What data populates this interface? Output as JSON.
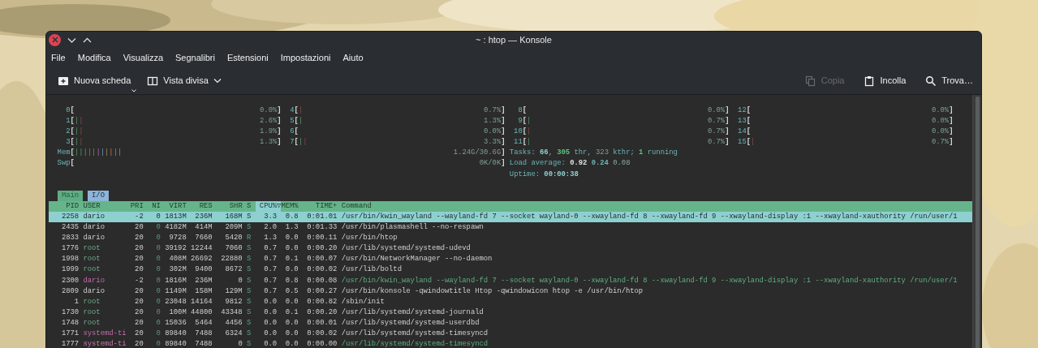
{
  "window": {
    "title": "~ : htop — Konsole"
  },
  "menu": [
    "File",
    "Modifica",
    "Visualizza",
    "Segnalibri",
    "Estensioni",
    "Impostazioni",
    "Aiuto"
  ],
  "toolbar": {
    "left": [
      {
        "label": "Nuova scheda",
        "kind": "new-tab"
      },
      {
        "label": "Vista divisa",
        "kind": "split"
      }
    ],
    "right": [
      {
        "label": "Copia",
        "kind": "copy",
        "disabled": true
      },
      {
        "label": "Incolla",
        "kind": "paste",
        "disabled": false
      },
      {
        "label": "Trova…",
        "kind": "find",
        "disabled": false
      }
    ]
  },
  "htop": {
    "meter_brackets": [
      "[",
      "]"
    ],
    "cpu_meters": [
      {
        "label": "0",
        "value": "0.0%"
      },
      {
        "label": "4",
        "bars": [
          {
            "text": "|",
            "kind": "kernel"
          }
        ],
        "value": "0.7%"
      },
      {
        "label": "8",
        "value": "0.0%"
      },
      {
        "label": "12",
        "value": "0.0%"
      },
      {
        "label": "1",
        "bars": [
          {
            "text": "|",
            "kind": "user"
          },
          {
            "text": "|",
            "kind": "kernel"
          }
        ],
        "value": "2.6%"
      },
      {
        "label": "5",
        "bars": [
          {
            "text": "|",
            "kind": "user"
          }
        ],
        "value": "1.3%"
      },
      {
        "label": "9",
        "bars": [
          {
            "text": "|",
            "kind": "user"
          }
        ],
        "value": "0.7%"
      },
      {
        "label": "13",
        "value": "0.0%"
      },
      {
        "label": "2",
        "bars": [
          {
            "text": "|",
            "kind": "user"
          },
          {
            "text": "|",
            "kind": "kernel"
          }
        ],
        "value": "1.9%"
      },
      {
        "label": "6",
        "value": "0.0%"
      },
      {
        "label": "10",
        "bars": [
          {
            "text": "|",
            "kind": "kernel"
          }
        ],
        "value": "0.7%"
      },
      {
        "label": "14",
        "value": "0.0%"
      },
      {
        "label": "3",
        "bars": [
          {
            "text": "|",
            "kind": "user"
          },
          {
            "text": "|",
            "kind": "kernel"
          }
        ],
        "value": "1.3%"
      },
      {
        "label": "7",
        "bars": [
          {
            "text": "|",
            "kind": "user"
          },
          {
            "text": "|",
            "kind": "kernel"
          }
        ],
        "value": "3.3%"
      },
      {
        "label": "11",
        "bars": [
          {
            "text": "|",
            "kind": "user"
          }
        ],
        "value": "0.7%"
      },
      {
        "label": "15",
        "bars": [
          {
            "text": "|",
            "kind": "kernel"
          }
        ],
        "value": "0.7%"
      }
    ],
    "memory": {
      "label": "Mem",
      "bars": [
        {
          "text": "|||||",
          "kind": "user"
        },
        {
          "text": "|",
          "kind": "shared"
        },
        {
          "text": "|",
          "kind": "buffers"
        },
        {
          "text": "||||",
          "kind": "cache"
        }
      ],
      "value": "1.24G/30.6G"
    },
    "swap": {
      "label": "Swp",
      "value": "0K/0K"
    },
    "tasks": [
      {
        "text": "Tasks: ",
        "kind": "label"
      },
      {
        "text": "66",
        "kind": "count"
      },
      {
        "text": ", ",
        "kind": "label"
      },
      {
        "text": "305",
        "kind": "highlight"
      },
      {
        "text": " thr, ",
        "kind": "label"
      },
      {
        "text": "323",
        "kind": "dim"
      },
      {
        "text": " kthr; ",
        "kind": "label"
      },
      {
        "text": "1",
        "kind": "highlight"
      },
      {
        "text": " running",
        "kind": "label"
      }
    ],
    "load_average": [
      {
        "text": "Load average: ",
        "kind": "label"
      },
      {
        "text": "0.92 ",
        "kind": "load1"
      },
      {
        "text": "0.24 ",
        "kind": "load5"
      },
      {
        "text": "0.08",
        "kind": "load15"
      }
    ],
    "uptime": [
      {
        "text": "Uptime: ",
        "kind": "label"
      },
      {
        "text": "00:00:38",
        "kind": "count"
      }
    ],
    "tabs": [
      {
        "label": "Main",
        "selected": true
      },
      {
        "label": "I/O",
        "selected": false
      }
    ],
    "columns": [
      {
        "label": "PID",
        "sorted": false
      },
      {
        "label": "USER",
        "sorted": false
      },
      {
        "label": "PRI",
        "sorted": false
      },
      {
        "label": "NI",
        "sorted": false
      },
      {
        "label": "VIRT",
        "sorted": false
      },
      {
        "label": "RES",
        "sorted": false
      },
      {
        "label": "SHR",
        "sorted": false
      },
      {
        "label": "S",
        "sorted": false
      },
      {
        "label": "CPU%",
        "sorted": true,
        "sort_indicator": "▽"
      },
      {
        "label": "MEM%",
        "sorted": false
      },
      {
        "label": "TIME+",
        "sorted": false
      },
      {
        "label": "Command",
        "sorted": false
      }
    ],
    "rows": [
      {
        "cells": [
          "2258",
          "dario",
          "-2",
          "0",
          "1813M",
          "236M",
          "168M",
          "S",
          "3.3",
          "0.8",
          "0:01.01",
          "/usr/bin/kwin_wayland --wayland-fd 7 --socket wayland-0 --xwayland-fd 8 --xwayland-fd 9 --xwayland-display :1 --xwayland-xauthority /run/user/1"
        ],
        "selected": true,
        "thread": false,
        "kind": "self"
      },
      {
        "cells": [
          "2435",
          "dario",
          "20",
          "0",
          "4182M",
          "414M",
          "209M",
          "S",
          "2.0",
          "1.3",
          "0:01.33",
          "/usr/bin/plasmashell --no-respawn"
        ],
        "selected": false,
        "thread": false,
        "kind": "self"
      },
      {
        "cells": [
          "2833",
          "dario",
          "20",
          "0",
          "9728",
          "7660",
          "5420",
          "R",
          "1.3",
          "0.0",
          "0:00.11",
          "/usr/bin/htop"
        ],
        "selected": false,
        "thread": false,
        "kind": "self"
      },
      {
        "cells": [
          "1776",
          "root",
          "20",
          "0",
          "39192",
          "12244",
          "7060",
          "S",
          "0.7",
          "0.0",
          "0:00.20",
          "/usr/lib/systemd/systemd-udevd"
        ],
        "selected": false,
        "thread": false,
        "kind": "root"
      },
      {
        "cells": [
          "1998",
          "root",
          "20",
          "0",
          "408M",
          "26692",
          "22880",
          "S",
          "0.7",
          "0.1",
          "0:00.07",
          "/usr/bin/NetworkManager --no-daemon"
        ],
        "selected": false,
        "thread": false,
        "kind": "root"
      },
      {
        "cells": [
          "1999",
          "root",
          "20",
          "0",
          "302M",
          "9400",
          "8672",
          "S",
          "0.7",
          "0.0",
          "0:00.02",
          "/usr/lib/boltd"
        ],
        "selected": false,
        "thread": false,
        "kind": "root"
      },
      {
        "cells": [
          "2300",
          "dario",
          "-2",
          "0",
          "1816M",
          "236M",
          "0",
          "S",
          "0.7",
          "0.8",
          "0:00.08",
          "/usr/bin/kwin_wayland --wayland-fd 7 --socket wayland-0 --xwayland-fd 8 --xwayland-fd 9 --xwayland-display :1 --xwayland-xauthority /run/user/1"
        ],
        "selected": false,
        "thread": true,
        "kind": "self"
      },
      {
        "cells": [
          "2809",
          "dario",
          "20",
          "0",
          "1149M",
          "158M",
          "129M",
          "S",
          "0.7",
          "0.5",
          "0:00.27",
          "/usr/bin/konsole -qwindowtitle Htop -qwindowicon htop -e /usr/bin/htop"
        ],
        "selected": false,
        "thread": false,
        "kind": "self"
      },
      {
        "cells": [
          "1",
          "root",
          "20",
          "0",
          "23048",
          "14164",
          "9812",
          "S",
          "0.0",
          "0.0",
          "0:00.82",
          "/sbin/init"
        ],
        "selected": false,
        "thread": false,
        "kind": "root"
      },
      {
        "cells": [
          "1730",
          "root",
          "20",
          "0",
          "100M",
          "44800",
          "43348",
          "S",
          "0.0",
          "0.1",
          "0:00.20",
          "/usr/lib/systemd/systemd-journald"
        ],
        "selected": false,
        "thread": false,
        "kind": "root"
      },
      {
        "cells": [
          "1748",
          "root",
          "20",
          "0",
          "15036",
          "5464",
          "4456",
          "S",
          "0.0",
          "0.0",
          "0:00.01",
          "/usr/lib/systemd/systemd-userdbd"
        ],
        "selected": false,
        "thread": false,
        "kind": "root"
      },
      {
        "cells": [
          "1771",
          "systemd-ti",
          "20",
          "0",
          "89840",
          "7488",
          "6324",
          "S",
          "0.0",
          "0.0",
          "0:00.02",
          "/usr/lib/systemd/systemd-timesyncd"
        ],
        "selected": false,
        "thread": false,
        "kind": "system"
      },
      {
        "cells": [
          "1777",
          "systemd-ti",
          "20",
          "0",
          "89840",
          "7488",
          "0",
          "S",
          "0.0",
          "0.0",
          "0:00.00",
          "/usr/lib/systemd/systemd-timesyncd"
        ],
        "selected": false,
        "thread": true,
        "kind": "system"
      }
    ]
  }
}
